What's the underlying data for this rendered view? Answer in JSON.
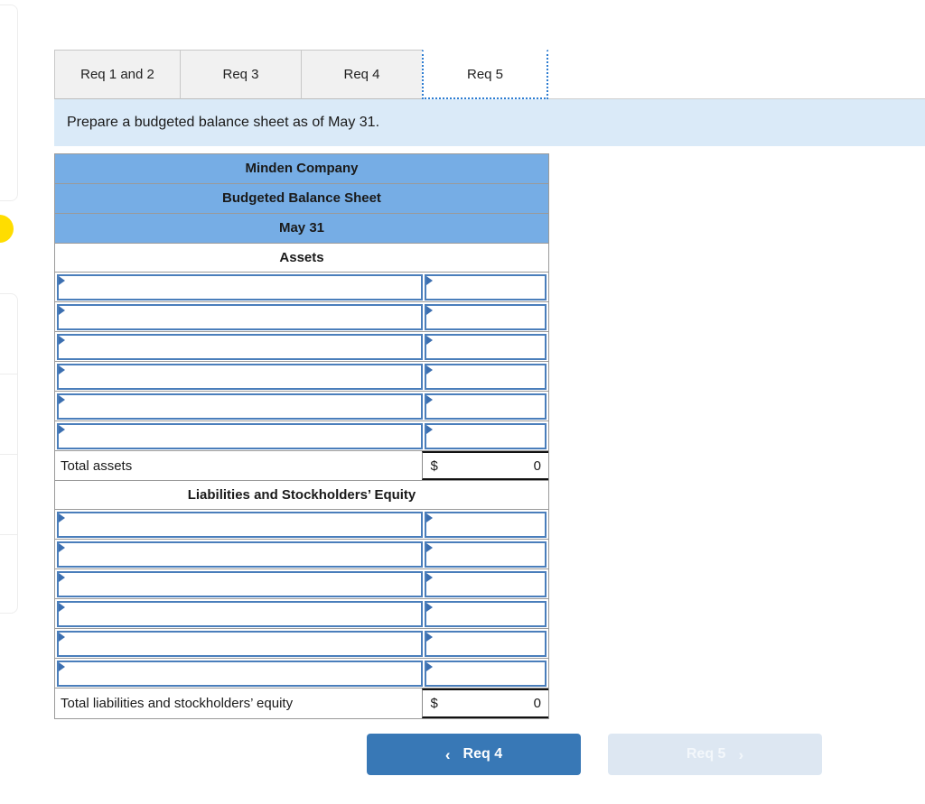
{
  "tabs": [
    {
      "label": "Req 1 and 2",
      "active": false
    },
    {
      "label": "Req 3",
      "active": false
    },
    {
      "label": "Req 4",
      "active": false
    },
    {
      "label": "Req 5",
      "active": true
    }
  ],
  "instruction": "Prepare a budgeted balance sheet as of May 31.",
  "worksheet": {
    "company": "Minden Company",
    "statement": "Budgeted Balance Sheet",
    "date": "May 31",
    "assets_heading": "Assets",
    "liabilities_heading": "Liabilities and Stockholders’ Equity",
    "asset_rows": [
      {
        "label": "",
        "value": ""
      },
      {
        "label": "",
        "value": ""
      },
      {
        "label": "",
        "value": ""
      },
      {
        "label": "",
        "value": ""
      },
      {
        "label": "",
        "value": ""
      },
      {
        "label": "",
        "value": ""
      }
    ],
    "total_assets": {
      "label": "Total assets",
      "currency": "$",
      "amount": "0"
    },
    "liability_rows": [
      {
        "label": "",
        "value": ""
      },
      {
        "label": "",
        "value": ""
      },
      {
        "label": "",
        "value": ""
      },
      {
        "label": "",
        "value": ""
      },
      {
        "label": "",
        "value": ""
      },
      {
        "label": "",
        "value": ""
      }
    ],
    "total_liabilities": {
      "label": "Total liabilities and stockholders’ equity",
      "currency": "$",
      "amount": "0"
    }
  },
  "nav": {
    "prev_label": "Req 4",
    "prev_chevron": "‹",
    "next_label": "Req 5",
    "next_chevron": "›"
  },
  "colors": {
    "header_blue": "#76ADE5",
    "banner_blue": "#DAEAF8",
    "input_border": "#4A7EBB",
    "button_blue": "#3878B6",
    "button_disabled": "#DDE7F2",
    "accent_yellow": "#FFDD00"
  }
}
